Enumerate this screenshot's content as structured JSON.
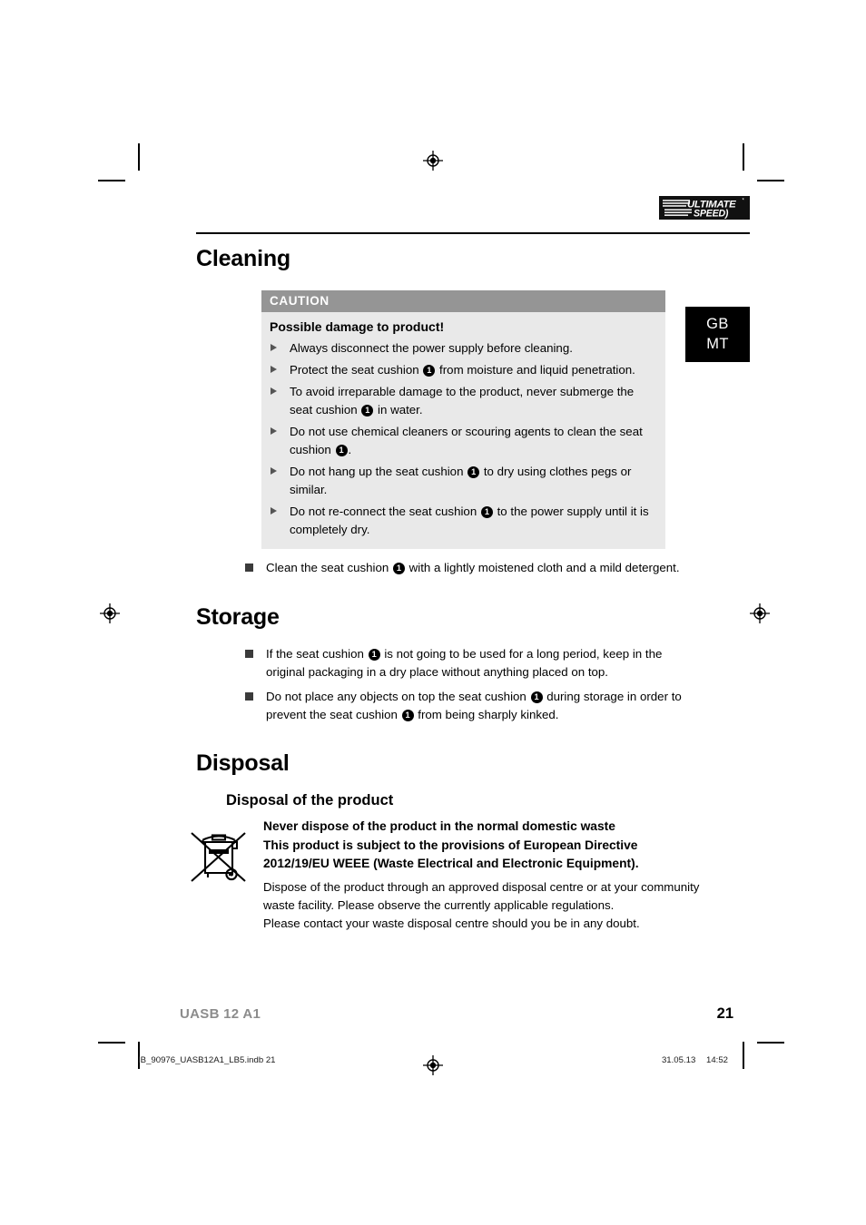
{
  "header": {
    "brand_logo": "ultimate-speed-logo",
    "brand_line1": "ULTIMATE",
    "brand_line2": "SPEED"
  },
  "language_tab": {
    "codes": [
      "GB",
      "MT"
    ]
  },
  "sections": {
    "cleaning": {
      "title": "Cleaning",
      "caution": {
        "header": "CAUTION",
        "lead": "Possible damage to product!",
        "items": [
          "Always disconnect the power supply before cleaning.",
          "Protect the seat cushion ① from moisture and liquid penetration.",
          "To avoid irreparable damage to the product, never submerge the seat cushion ① in water.",
          "Do not use chemical cleaners or scouring agents to clean the seat cushion ①.",
          "Do not hang up the seat cushion ① to dry using clothes pegs or similar.",
          "Do not re-connect the seat cushion ① to the power supply until it is completely dry."
        ]
      },
      "after_items": [
        "Clean the seat cushion ① with a lightly moistened cloth and a mild detergent."
      ]
    },
    "storage": {
      "title": "Storage",
      "items": [
        "If the seat cushion ① is not going to be used for a long period, keep in the original packaging in a dry place without anything placed on top.",
        "Do not place any objects on top the seat cushion ① during storage in order to prevent the seat cushion ① from being sharply kinked."
      ]
    },
    "disposal": {
      "title": "Disposal",
      "subtitle": "Disposal of the product",
      "icon": "weee-crossed-out-wheelie-bin-icon",
      "bold_lines": [
        "Never dispose of the product in the normal domestic waste",
        "This product is subject to the provisions of European Directive",
        "2012/19/EU WEEE (Waste Electrical and Electronic Equipment)."
      ],
      "body_lines": [
        "Dispose of the product through an approved disposal centre or at your community",
        "waste facility. Please observe the currently applicable regulations.",
        "Please contact your waste disposal centre should you be in any doubt."
      ]
    }
  },
  "footer": {
    "model": "UASB 12 A1",
    "page_number": "21",
    "print_file": "IB_90976_UASB12A1_LB5.indb   21",
    "print_date": "31.05.13",
    "print_time": "14:52"
  },
  "colors": {
    "caution_header_bg": "#959595",
    "caution_body_bg": "#e9e9e9",
    "lang_tab_bg": "#000000",
    "footer_model": "#8c8c8c"
  }
}
